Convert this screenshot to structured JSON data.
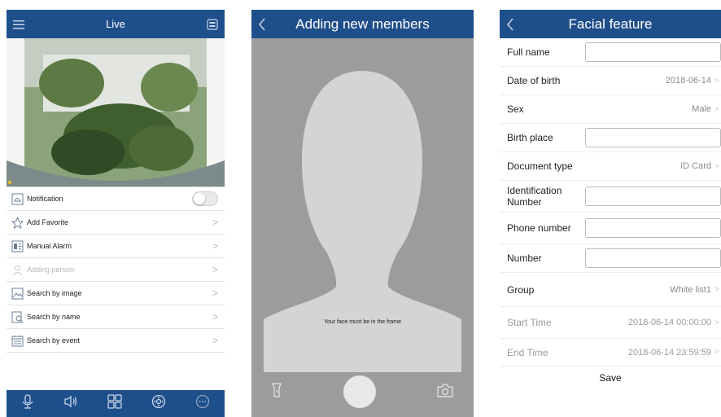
{
  "live_screen": {
    "title": "Live",
    "menu_icon": "hamburger-icon",
    "multiscreen_icon": "multiscreen-icon",
    "menu": [
      {
        "label": "Notification",
        "icon": "notification-icon",
        "control": "toggle",
        "toggle_on": false,
        "disabled": false
      },
      {
        "label": "Add Favorite",
        "icon": "star-icon",
        "control": "chevron",
        "disabled": false
      },
      {
        "label": "Manual Alarm",
        "icon": "alarm-icon",
        "control": "chevron",
        "disabled": false
      },
      {
        "label": "Adding person",
        "icon": "person-icon",
        "control": "chevron",
        "disabled": true
      },
      {
        "label": "Search by image",
        "icon": "image-search-icon",
        "control": "chevron",
        "disabled": false
      },
      {
        "label": "Search by name",
        "icon": "name-search-icon",
        "control": "chevron",
        "disabled": false
      },
      {
        "label": "Search by event",
        "icon": "event-search-icon",
        "control": "chevron",
        "disabled": false
      }
    ],
    "bottom_bar_icons": [
      "microphone-icon",
      "speaker-icon",
      "grid-icon",
      "ptz-icon",
      "more-icon"
    ]
  },
  "camera_screen": {
    "title": "Adding new members",
    "hint": "Your face must be in the frame",
    "bottom_icons": [
      "flashlight-icon",
      "shutter-button",
      "switch-camera-icon"
    ]
  },
  "form_screen": {
    "title": "Facial feature",
    "fields": [
      {
        "label": "Full name",
        "type": "input",
        "value": ""
      },
      {
        "label": "Date of birth",
        "type": "select",
        "value": "2018-06-14"
      },
      {
        "label": "Sex",
        "type": "select",
        "value": "Male"
      },
      {
        "label": "Birth place",
        "type": "input",
        "value": ""
      },
      {
        "label": "Document type",
        "type": "select",
        "value": "ID Card"
      },
      {
        "label": "Identification Number",
        "type": "input",
        "value": ""
      },
      {
        "label": "Phone number",
        "type": "input",
        "value": ""
      },
      {
        "label": "Number",
        "type": "input",
        "value": ""
      },
      {
        "label": "Group",
        "type": "select",
        "value": "White list1"
      },
      {
        "label": "Start Time",
        "type": "select",
        "value": "2018-06-14 00:00:00",
        "faded": true
      },
      {
        "label": "End Time",
        "type": "select",
        "value": "2018-06-14 23:59:59",
        "faded": true
      }
    ],
    "save_label": "Save"
  },
  "colors": {
    "navbar": "#1f4f8b",
    "camera_bg": "#9c9c9c",
    "silhouette": "#d4d4d4"
  }
}
